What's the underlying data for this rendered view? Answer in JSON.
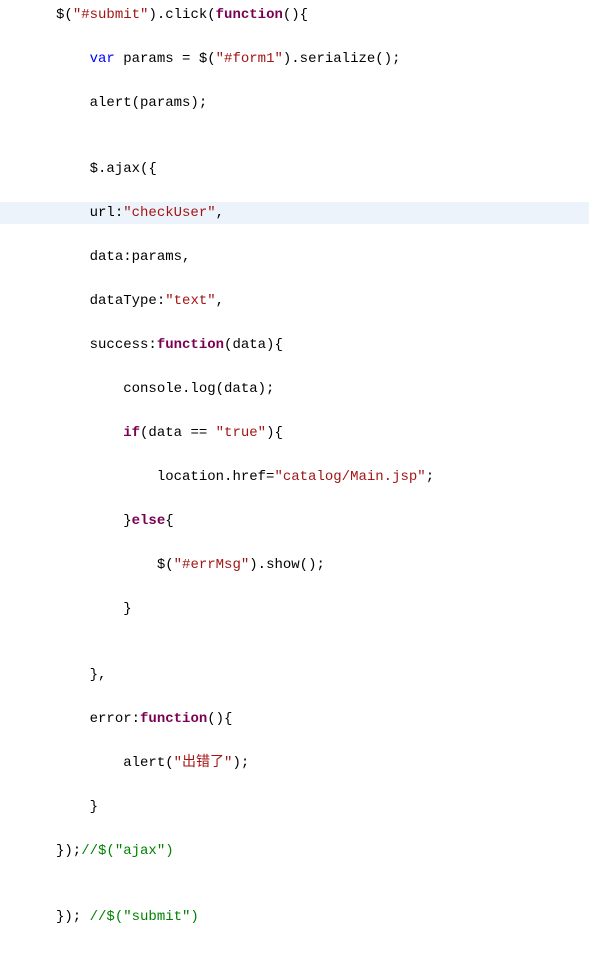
{
  "code": {
    "lines": [
      {
        "hl": false,
        "tokens": [
          {
            "t": "$(",
            "c": "punct"
          },
          {
            "t": "\"#submit\"",
            "c": "str"
          },
          {
            "t": ").click(",
            "c": "punct"
          },
          {
            "t": "function",
            "c": "kw2"
          },
          {
            "t": "(){",
            "c": "punct"
          }
        ],
        "indent": 0
      },
      {
        "hl": false,
        "tokens": [
          {
            "t": "var",
            "c": "kw"
          },
          {
            "t": " params = $(",
            "c": "punct"
          },
          {
            "t": "\"#form1\"",
            "c": "str"
          },
          {
            "t": ").serialize();",
            "c": "punct"
          }
        ],
        "indent": 1
      },
      {
        "hl": false,
        "tokens": [
          {
            "t": "alert(params);",
            "c": "punct"
          }
        ],
        "indent": 1
      },
      {
        "hl": false,
        "tokens": [],
        "indent": 0
      },
      {
        "hl": false,
        "tokens": [
          {
            "t": "$.ajax({",
            "c": "punct"
          }
        ],
        "indent": 1
      },
      {
        "hl": true,
        "tokens": [
          {
            "t": "url:",
            "c": "punct"
          },
          {
            "t": "\"checkUser\"",
            "c": "str"
          },
          {
            "t": ",",
            "c": "punct"
          }
        ],
        "indent": 1
      },
      {
        "hl": false,
        "tokens": [
          {
            "t": "data:params,",
            "c": "punct"
          }
        ],
        "indent": 1
      },
      {
        "hl": false,
        "tokens": [
          {
            "t": "dataType:",
            "c": "punct"
          },
          {
            "t": "\"text\"",
            "c": "str"
          },
          {
            "t": ",",
            "c": "punct"
          }
        ],
        "indent": 1
      },
      {
        "hl": false,
        "tokens": [
          {
            "t": "success:",
            "c": "punct"
          },
          {
            "t": "function",
            "c": "kw2"
          },
          {
            "t": "(data){",
            "c": "punct"
          }
        ],
        "indent": 1
      },
      {
        "hl": false,
        "tokens": [
          {
            "t": "console.log(data);",
            "c": "punct"
          }
        ],
        "indent": 2
      },
      {
        "hl": false,
        "tokens": [
          {
            "t": "if",
            "c": "kw2"
          },
          {
            "t": "(data == ",
            "c": "punct"
          },
          {
            "t": "\"true\"",
            "c": "str"
          },
          {
            "t": "){",
            "c": "punct"
          }
        ],
        "indent": 2
      },
      {
        "hl": false,
        "tokens": [
          {
            "t": "location.href=",
            "c": "punct"
          },
          {
            "t": "\"catalog/Main.jsp\"",
            "c": "str"
          },
          {
            "t": ";",
            "c": "punct"
          }
        ],
        "indent": 3
      },
      {
        "hl": false,
        "tokens": [
          {
            "t": "}",
            "c": "punct"
          },
          {
            "t": "else",
            "c": "kw2"
          },
          {
            "t": "{",
            "c": "punct"
          }
        ],
        "indent": 2
      },
      {
        "hl": false,
        "tokens": [
          {
            "t": "$(",
            "c": "punct"
          },
          {
            "t": "\"#errMsg\"",
            "c": "str"
          },
          {
            "t": ").show();",
            "c": "punct"
          }
        ],
        "indent": 3
      },
      {
        "hl": false,
        "tokens": [
          {
            "t": "}",
            "c": "punct"
          }
        ],
        "indent": 2
      },
      {
        "hl": false,
        "tokens": [],
        "indent": 0
      },
      {
        "hl": false,
        "tokens": [
          {
            "t": "},",
            "c": "punct"
          }
        ],
        "indent": 1
      },
      {
        "hl": false,
        "tokens": [
          {
            "t": "error:",
            "c": "punct"
          },
          {
            "t": "function",
            "c": "kw2"
          },
          {
            "t": "(){",
            "c": "punct"
          }
        ],
        "indent": 1
      },
      {
        "hl": false,
        "tokens": [
          {
            "t": "alert(",
            "c": "punct"
          },
          {
            "t": "\"出错了\"",
            "c": "str"
          },
          {
            "t": ");",
            "c": "punct"
          }
        ],
        "indent": 2
      },
      {
        "hl": false,
        "tokens": [
          {
            "t": "}",
            "c": "punct"
          }
        ],
        "indent": 1
      },
      {
        "hl": false,
        "tokens": [
          {
            "t": "});",
            "c": "punct"
          },
          {
            "t": "//$(\"ajax\")",
            "c": "comment"
          }
        ],
        "indent": 0
      },
      {
        "hl": false,
        "tokens": [],
        "indent": 0
      },
      {
        "hl": false,
        "tokens": [
          {
            "t": "}); ",
            "c": "punct"
          },
          {
            "t": "//$(\"submit\")",
            "c": "comment"
          }
        ],
        "indent": 0
      }
    ],
    "indentUnit": "    "
  }
}
